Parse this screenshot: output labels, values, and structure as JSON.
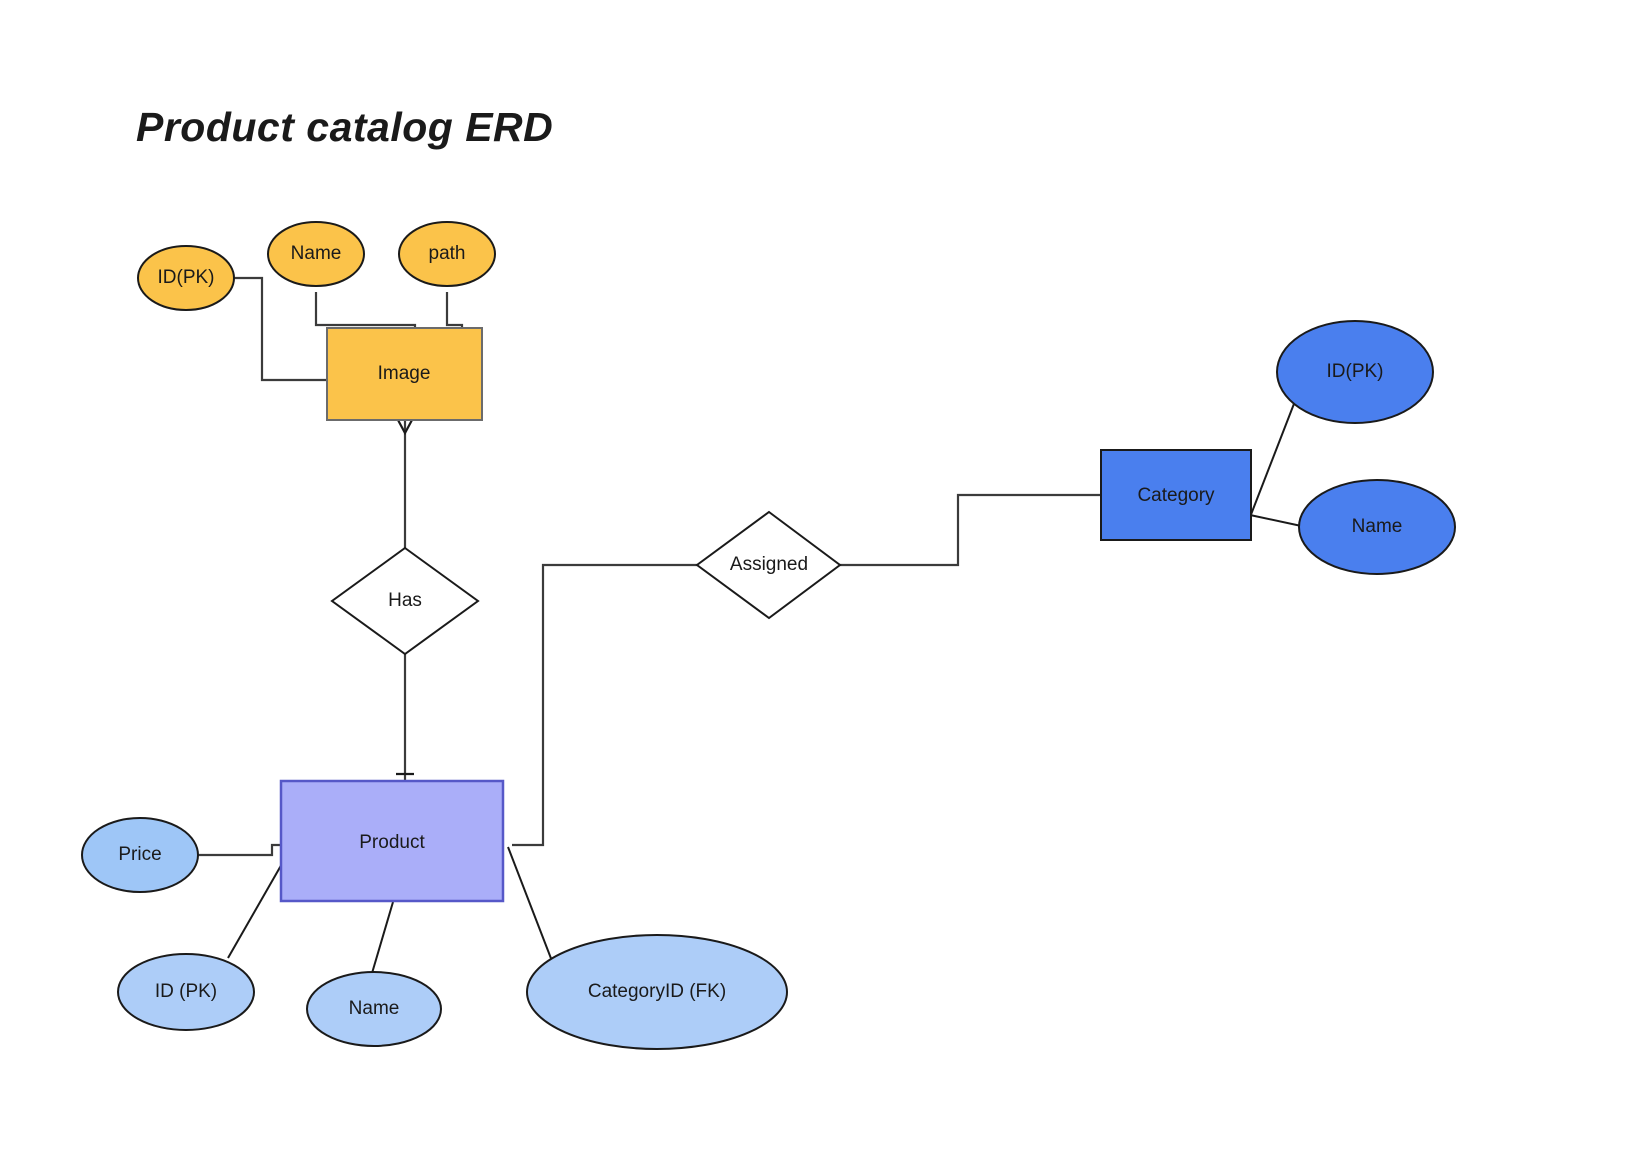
{
  "title": "Product catalog ERD",
  "colors": {
    "image_entity_fill": "#FBC34A",
    "image_entity_stroke": "#6b6b6b",
    "image_attr_fill": "#FBC34A",
    "category_entity_fill": "#4A7FEE",
    "category_attr_fill": "#4A7FEE",
    "product_entity_fill": "#AAAEF9",
    "product_entity_stroke": "#5658c8",
    "product_attr_fill": "#9EC6F7",
    "relationship_fill": "#FFFFFF",
    "relationship_stroke": "#1a1a1a",
    "connector": "#3b3b3b",
    "text": "#1a1a1a"
  },
  "entities": [
    {
      "id": "image",
      "label": "Image",
      "shape": "rectangle"
    },
    {
      "id": "category",
      "label": "Category",
      "shape": "rectangle"
    },
    {
      "id": "product",
      "label": "Product",
      "shape": "rectangle"
    }
  ],
  "relationships": [
    {
      "id": "has",
      "label": "Has",
      "shape": "diamond",
      "from": "image",
      "to": "product"
    },
    {
      "id": "assigned",
      "label": "Assigned",
      "shape": "diamond",
      "from": "product",
      "to": "category"
    }
  ],
  "attributes": {
    "image": [
      {
        "id": "image-id",
        "label": "ID(PK)"
      },
      {
        "id": "image-name",
        "label": "Name"
      },
      {
        "id": "image-path",
        "label": "path"
      }
    ],
    "category": [
      {
        "id": "category-id",
        "label": "ID(PK)"
      },
      {
        "id": "category-name",
        "label": "Name"
      }
    ],
    "product": [
      {
        "id": "product-price",
        "label": "Price"
      },
      {
        "id": "product-id",
        "label": "ID (PK)"
      },
      {
        "id": "product-name",
        "label": "Name"
      },
      {
        "id": "product-categoryid",
        "label": "CategoryID (FK)"
      }
    ]
  }
}
